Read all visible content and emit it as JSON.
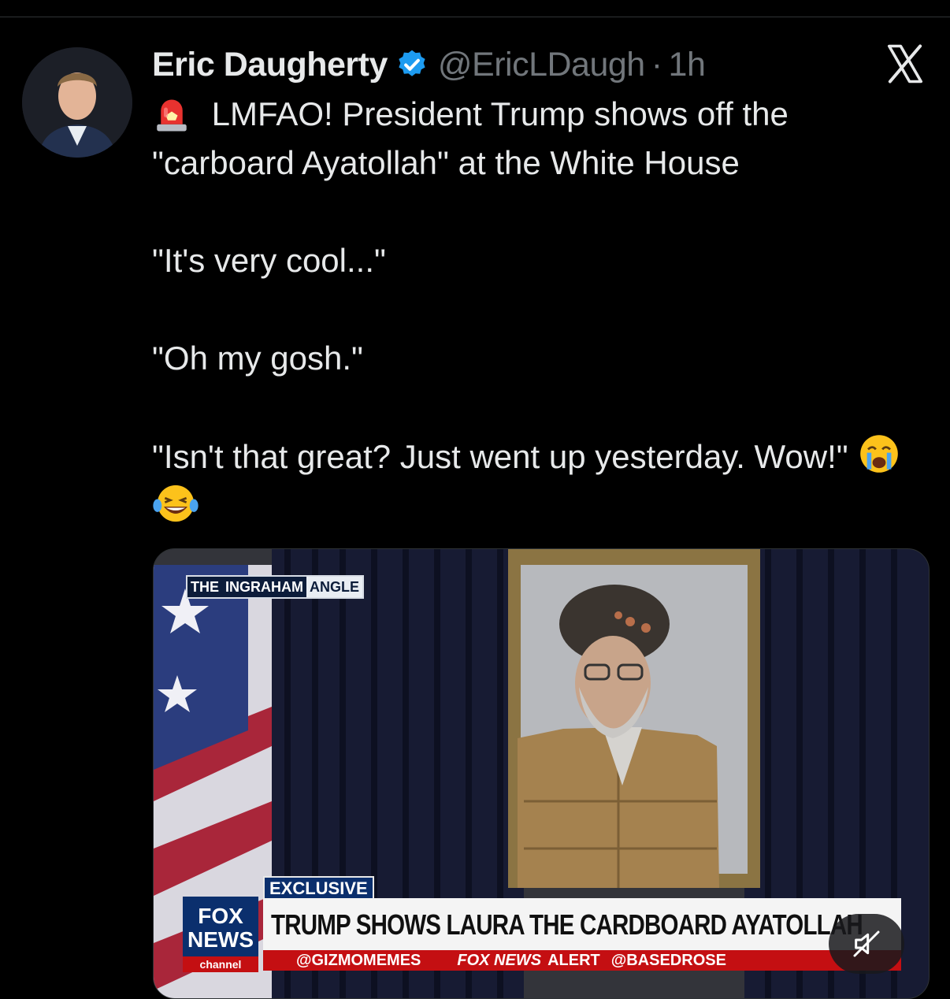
{
  "tweet": {
    "author_name": "Eric Daugherty",
    "handle": "@EricLDaugh",
    "separator": "·",
    "timestamp": "1h",
    "lines": [
      "LMFAO! President Trump shows off the \"carboard Ayatollah\" at the White House",
      "\"It's very cool...\"",
      "\"Oh my gosh.\"",
      "\"Isn't that great? Just went up yesterday. Wow!\""
    ]
  },
  "icons": {
    "verified": "verified-badge-icon",
    "close": "x-close-icon",
    "siren": "police-light-emoji",
    "crying": "crying-emoji",
    "laughing": "laughing-emoji",
    "mute": "muted-speaker-icon"
  },
  "video": {
    "show_name_a": "THE",
    "show_name_b": "INGRAHAM",
    "show_name_c": "ANGLE",
    "exclusive_label": "EXCLUSIVE",
    "headline": "TRUMP SHOWS LAURA THE CARDBOARD AYATOLLAH",
    "logo_line1": "FOX",
    "logo_line2": "NEWS",
    "logo_line3": "channel",
    "ticker_1": "@GIZMOMEMES",
    "ticker_2": "FOX NEWS",
    "ticker_3": "ALERT",
    "ticker_4": "@BASEDROSE"
  },
  "colors": {
    "background": "#000000",
    "text_primary": "#e7e9ea",
    "text_secondary": "#71767b",
    "verified_blue": "#1d9bf0",
    "fox_red": "#c40f12"
  }
}
